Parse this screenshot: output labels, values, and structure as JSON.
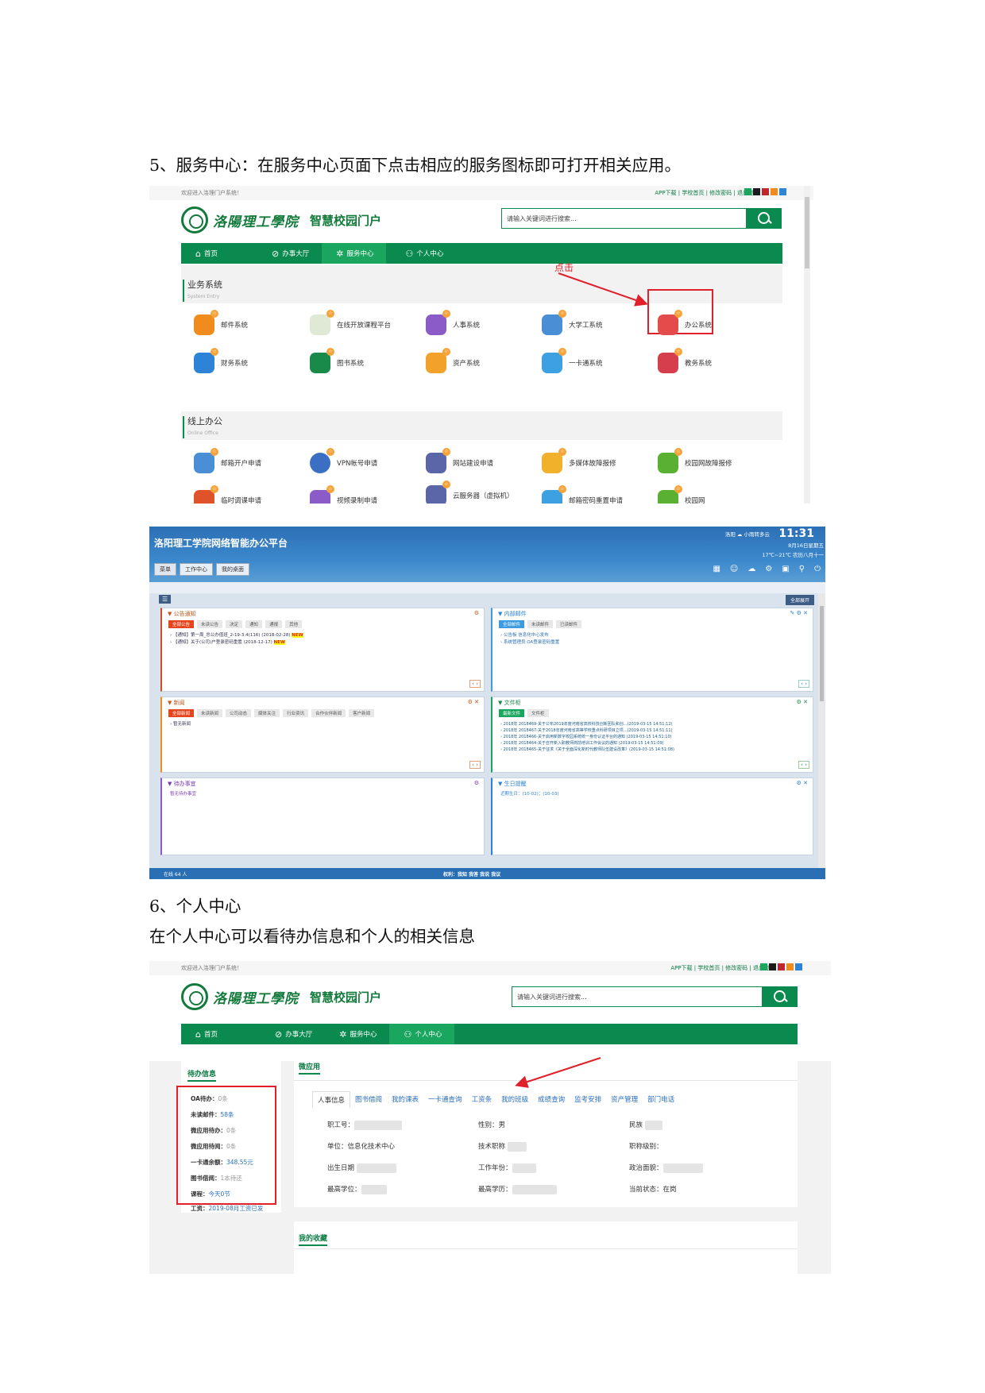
{
  "section5_heading": "5、服务中心：在服务中心页面下点击相应的服务图标即可打开相关应用。",
  "section6_heading": "6、个人中心",
  "section6_desc": "在个人中心可以看待办信息和个人的相关信息",
  "portal": {
    "welcome": "欢迎进入洛理门户系统！",
    "toplinks": "APP下载 | 学校首页 | 修改密码 | 退出登录",
    "swatch_colors": [
      "#1aa65f",
      "#1a1a1a",
      "#c0262d",
      "#f08c1e",
      "#2d84d6"
    ],
    "logo_text": "洛陽理工學院",
    "portal_name": "智慧校园门户",
    "search_placeholder": "请输入关键词进行搜索...",
    "nav": [
      "首页",
      "办事大厅",
      "服务中心",
      "个人中心"
    ],
    "click_label": "点击"
  },
  "service_center": {
    "business_title": "业务系统",
    "business_sub": "System Entry",
    "business_apps": [
      {
        "label": "邮件系统",
        "color": "#f08c1e"
      },
      {
        "label": "在线开放课程平台",
        "color": "#e8e8e8"
      },
      {
        "label": "人事系统",
        "color": "#8b5cc7"
      },
      {
        "label": "大学工系统",
        "color": "#4a8fd6"
      },
      {
        "label": "办公系统",
        "color": "#e44b4b"
      },
      {
        "label": "财务系统",
        "color": "#2d84d6"
      },
      {
        "label": "图书系统",
        "color": "#1a8a4a"
      },
      {
        "label": "资产系统",
        "color": "#f2a12b"
      },
      {
        "label": "一卡通系统",
        "color": "#3da0e0"
      },
      {
        "label": "教务系统",
        "color": "#d63e4e"
      }
    ],
    "online_title": "线上办公",
    "online_sub": "Online Office",
    "online_apps": [
      {
        "label": "邮箱开户申请",
        "color": "#4a8fd6"
      },
      {
        "label": "VPN帐号申请",
        "color": "#3b6fc4"
      },
      {
        "label": "网站建设申请",
        "color": "#5a66a8"
      },
      {
        "label": "多媒体故障报修",
        "color": "#f2b12b"
      },
      {
        "label": "校园网故障报修",
        "color": "#5ab030"
      },
      {
        "label": "临时调课申请",
        "color": "#e0522a"
      },
      {
        "label": "视频录制申请",
        "color": "#8b5cc7"
      },
      {
        "label": "云服务器（虚拟机）",
        "color": "#5a66a8"
      },
      {
        "label": "邮箱密码重置申请",
        "color": "#3da0e0"
      },
      {
        "label": "校园网",
        "color": "#5ab030"
      }
    ]
  },
  "oa": {
    "title": "洛阳理工学院网络智能办公平台",
    "time": "11:31",
    "weather": "洛阳 ☁ 小雨转多云",
    "temp": "17℃~21℃",
    "date": "8月16日星期五",
    "lunar": "农历八月十一",
    "tabs": [
      "菜单",
      "工作中心",
      "我的桌面"
    ],
    "expand": "全部展开",
    "cards": [
      {
        "title": "公告通知",
        "chips": [
          "全部公告",
          "未读公告",
          "决定",
          "通知",
          "通报",
          "其他"
        ],
        "lines": [
          "【通知】第一周_总公办值班_2-19-3.4(116) (2018-02-28)",
          "【通知】关于(公司)户登录密码重置 (2018-12-17)"
        ],
        "tag": "NEW"
      },
      {
        "title": "内部邮件",
        "chips": [
          "全部邮件",
          "未读邮件",
          "已读邮件"
        ],
        "lines": [
          "公告板 信息化中心发布",
          "系统管理员 OA登录密码重置"
        ]
      },
      {
        "title": "新闻",
        "chips": [
          "全部新闻",
          "未读新闻",
          "公司动态",
          "媒体关注",
          "行业资讯",
          "合作伙伴新闻",
          "客户新闻"
        ],
        "lines": [
          "暂无新闻"
        ]
      },
      {
        "title": "文件柜",
        "chips": [
          "最新文件",
          "文件柜"
        ],
        "lines": [
          "2018年 2018469-关于公布2019年度河南省高校科技创新团队和创...(2019-03-15 14:51:12)",
          "2018年 2018467-关于2018年度河南省高等学校重点科研项目立项...(2019-03-15 14:51:11)",
          "2018年 2018466-关于启用新数字校园系统统一身份认证平台的通知 (2019-03-15 14:51:10)",
          "2018年 2018464-关于召开新入职教师岗前培训工作会议的通知 (2019-03-15 14:51:09)",
          "2018年 2018465-关于征求《关于全面深化新时代教师队伍建设改革》(2019-03-15 14:51:08)"
        ]
      },
      {
        "title": "待办事宜",
        "chips": [],
        "lines": [
          "暂无待办事宜"
        ]
      },
      {
        "title": "生日提醒",
        "chips": [],
        "lines": [
          "近期生日：(10-02)；(10-03)"
        ]
      }
    ],
    "status_left": "在线 64 人",
    "status_mid": "权利：我知 我答 我说 我议"
  },
  "personal_center": {
    "todo_title": "待办信息",
    "todo_rows": [
      {
        "k": "OA待办：",
        "v": "0条"
      },
      {
        "k": "未读邮件：",
        "v": "58条"
      },
      {
        "k": "微应用待办：",
        "v": "0条"
      },
      {
        "k": "微应用待阅：",
        "v": "0条"
      },
      {
        "k": "一卡通余额：",
        "v": "348.55元"
      },
      {
        "k": "图书借阅：",
        "v": "1本待还"
      },
      {
        "k": "课程：",
        "v": "今天0节"
      },
      {
        "k": "工资：",
        "v": "2019-08月工资已发"
      }
    ],
    "micro_title": "微应用",
    "micro_tabs": [
      "人事信息",
      "图书借阅",
      "我的课表",
      "一卡通查询",
      "工资条",
      "我的班级",
      "成绩查询",
      "监考安排",
      "资产管理",
      "部门电话"
    ],
    "fields": [
      {
        "k": "职工号：",
        "v": ""
      },
      {
        "k": "性别：",
        "v": "男"
      },
      {
        "k": "民族",
        "v": ""
      },
      {
        "k": "单位：",
        "v": "信息化技术中心"
      },
      {
        "k": "技术职称",
        "v": ""
      },
      {
        "k": "职称级别：",
        "v": ""
      },
      {
        "k": "出生日期",
        "v": ""
      },
      {
        "k": "工作年份：",
        "v": ""
      },
      {
        "k": "政治面貌：",
        "v": ""
      },
      {
        "k": "最高学位：",
        "v": ""
      },
      {
        "k": "最高学历：",
        "v": ""
      },
      {
        "k": "当前状态：",
        "v": "在岗"
      }
    ],
    "favorites_title": "我的收藏"
  }
}
